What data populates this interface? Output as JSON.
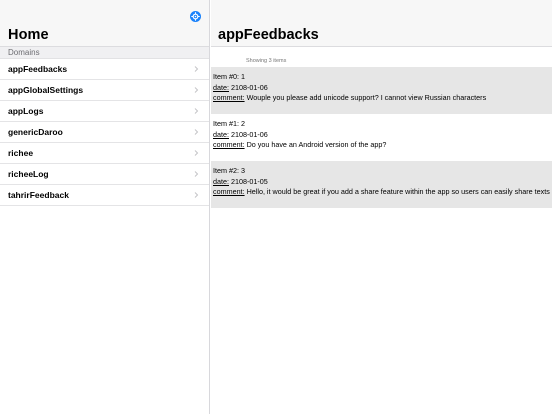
{
  "sidebar": {
    "title": "Home",
    "section_label": "Domains",
    "items": [
      {
        "label": "appFeedbacks"
      },
      {
        "label": "appGlobalSettings"
      },
      {
        "label": "appLogs"
      },
      {
        "label": "genericDaroo"
      },
      {
        "label": "richee"
      },
      {
        "label": "richeeLog"
      },
      {
        "label": "tahrirFeedback"
      }
    ]
  },
  "main": {
    "title": "appFeedbacks",
    "count_text": "Showing 3 items",
    "field_labels": {
      "date": "date:",
      "comment": "comment:"
    },
    "items": [
      {
        "header": "Item #0: 1",
        "date": "2108-01-06",
        "comment": "Wouple you please add unicode support? I cannot view Russian characters"
      },
      {
        "header": "Item #1: 2",
        "date": "2108-01-06",
        "comment": "Do you have an Android version of the app?"
      },
      {
        "header": "Item #2: 3",
        "date": "2108-01-05",
        "comment": "Hello, it would be great if you add a share feature within the app so users can easily share texts"
      }
    ]
  },
  "colors": {
    "accent": "#1a82fb",
    "row_shade": "#e6e6e6",
    "header_bg": "#f7f7f7"
  },
  "icons": {
    "settings": "gear-icon",
    "disclosure": "chevron-right-icon"
  }
}
